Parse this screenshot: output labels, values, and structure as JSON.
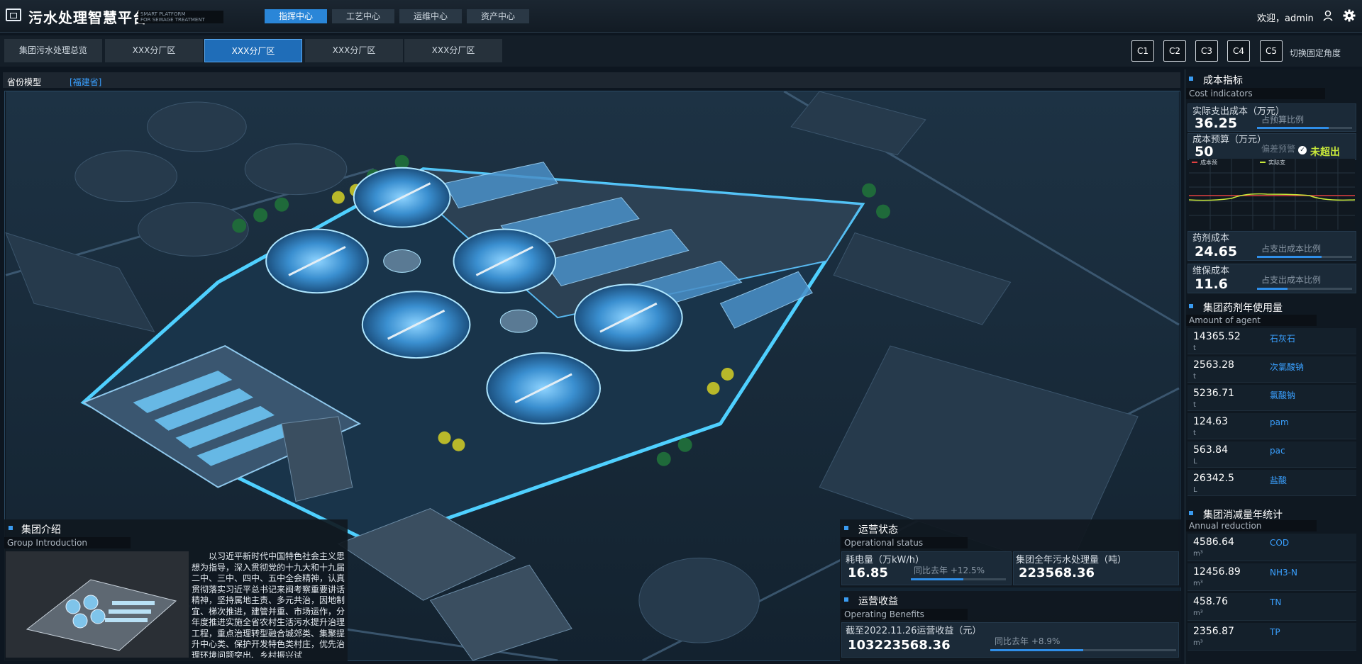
{
  "header": {
    "title": "污水处理智慧平台",
    "subtitle_line1": "SMART PLATFORM",
    "subtitle_line2": "FOR SEWAGE TREATMENT",
    "nav": [
      "指挥中心",
      "工艺中心",
      "运维中心",
      "资产中心"
    ],
    "welcome": "欢迎，admin"
  },
  "tabs": {
    "items": [
      "集团污水处理总览",
      "XXX分厂区",
      "XXX分厂区",
      "XXX分厂区",
      "XXX分厂区"
    ],
    "cameras": [
      "C1",
      "C2",
      "C3",
      "C4",
      "C5"
    ],
    "camera_label": "切换固定角度"
  },
  "model": {
    "label": "省份模型",
    "province": "[福建省]"
  },
  "intro": {
    "title": "集团介绍",
    "subtitle": "Group Introduction",
    "text": "以习近平新时代中国特色社会主义思想为指导，深入贯彻党的十九大和十九届二中、三中、四中、五中全会精神，认真贯彻落实习近平总书记来闽考察重要讲话精神，坚持属地主责、多元共治，因地制宜、梯次推进，建管并重、市场运作，分年度推进实施全省农村生活污水提升治理工程，重点治理转型融合城郊类、集聚提升中心类、保护开发特色类村庄，优先治理环境问题突出、乡村振兴试"
  },
  "ops_status": {
    "title": "运营状态",
    "subtitle": "Operational status",
    "power_label": "耗电量（万kW/h）",
    "power_value": "16.85",
    "power_yoy": "同比去年 +12.5%",
    "power_ratio": 0.55,
    "sewage_label": "集团全年污水处理量（吨）",
    "sewage_value": "223568.36"
  },
  "ops_benefit": {
    "title": "运营收益",
    "subtitle": "Operating Benefits",
    "label": "截至2022.11.26运营收益（元）",
    "value": "103223568.36",
    "yoy": "同比去年 +8.9%",
    "ratio": 0.5
  },
  "cost": {
    "title": "成本指标",
    "subtitle": "Cost indicators",
    "actual_label": "实际支出成本（万元）",
    "actual_value": "36.25",
    "actual_ratio_label": "占预算比例",
    "actual_ratio": 0.75,
    "budget_label": "成本预算（万元）",
    "budget_value": "50",
    "budget_ratio_label": "偏差预警",
    "budget_status": "未超出",
    "legend": [
      "成本预",
      "实际支"
    ],
    "chemical_label": "药剂成本",
    "chemical_value": "24.65",
    "chemical_ratio_label": "占支出成本比例",
    "chemical_ratio": 0.68,
    "maint_label": "维保成本",
    "maint_value": "11.6",
    "maint_ratio_label": "占支出成本比例",
    "maint_ratio": 0.32
  },
  "agent": {
    "title": "集团药剂年使用量",
    "subtitle": "Amount of agent",
    "items": [
      {
        "value": "14365.52",
        "name": "石灰石",
        "unit": "t"
      },
      {
        "value": "2563.28",
        "name": "次氯酸钠",
        "unit": "t"
      },
      {
        "value": "5236.71",
        "name": "氯酸钠",
        "unit": "t"
      },
      {
        "value": "124.63",
        "name": "pam",
        "unit": "t"
      },
      {
        "value": "563.84",
        "name": "pac",
        "unit": "L"
      },
      {
        "value": "26342.5",
        "name": "盐酸",
        "unit": "L"
      }
    ]
  },
  "reduction": {
    "title": "集团消减量年统计",
    "subtitle": "Annual reduction",
    "items": [
      {
        "value": "4586.64",
        "name": "COD",
        "unit": "m³"
      },
      {
        "value": "12456.89",
        "name": "NH3-N",
        "unit": "m³"
      },
      {
        "value": "458.76",
        "name": "TN",
        "unit": "m³"
      },
      {
        "value": "2356.87",
        "name": "TP",
        "unit": "m³"
      }
    ]
  },
  "colors": {
    "accent": "#2f8ee8",
    "link": "#3aa0ff",
    "ok": "#c8e83a"
  }
}
